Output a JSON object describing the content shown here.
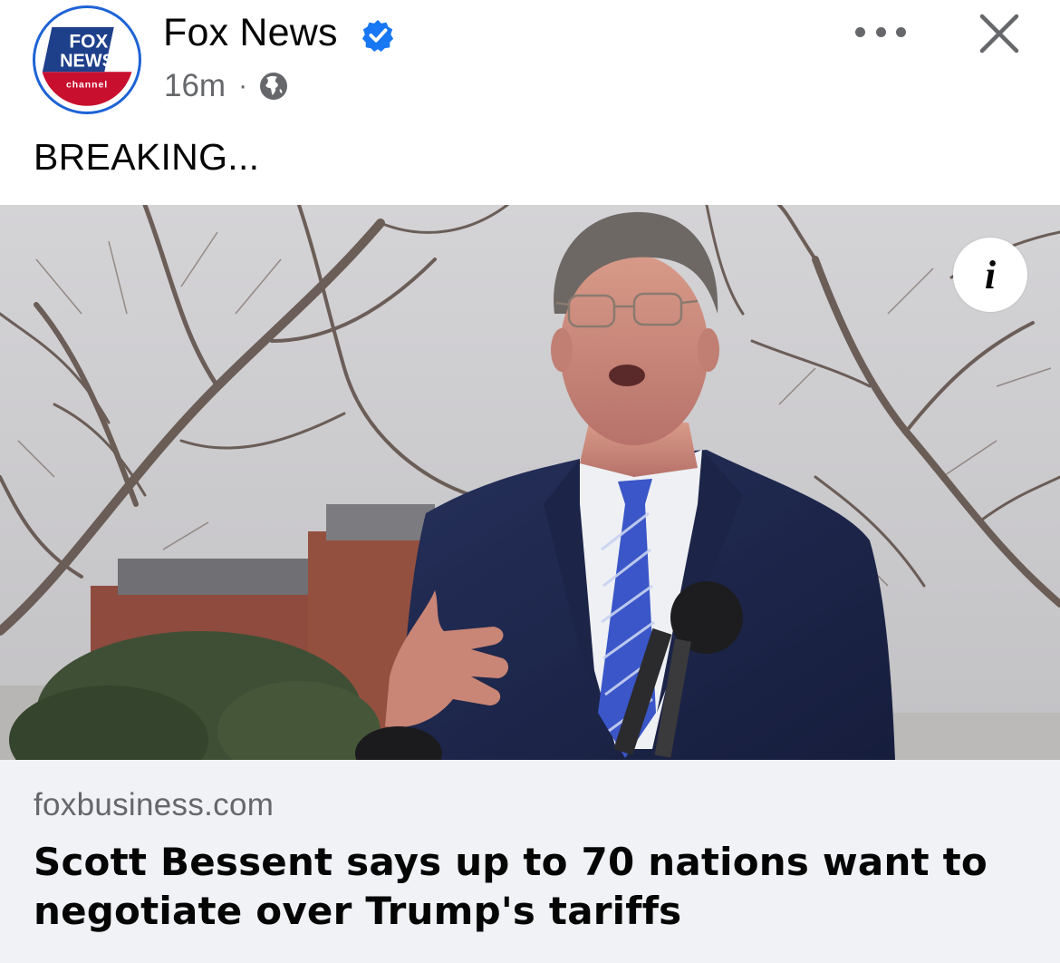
{
  "post": {
    "page_name": "Fox News",
    "verified": true,
    "timestamp": "16m",
    "separator": "·",
    "audience_icon": "globe-icon",
    "text": "BREAKING..."
  },
  "avatar": {
    "logo_line1": "FOX",
    "logo_line2": "NEWS",
    "logo_line3": "channel",
    "brand_blue": "#1e63d6",
    "brand_red": "#c8102e"
  },
  "controls": {
    "more_icon": "more-options-icon",
    "close_icon": "close-icon",
    "info_label": "i"
  },
  "link_preview": {
    "domain": "foxbusiness.com",
    "headline": "Scott Bessent says up to 70 nations want to negotiate over Trump's tariffs"
  },
  "colors": {
    "text_primary": "#050505",
    "text_secondary": "#65676b",
    "card_background": "#f0f2f5",
    "verified_badge": "#1877f2"
  }
}
